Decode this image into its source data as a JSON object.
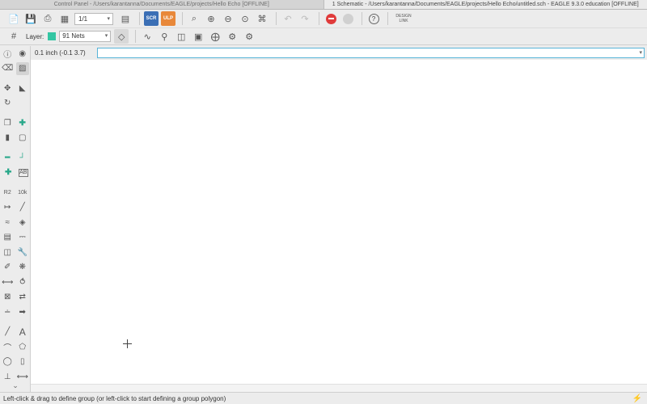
{
  "tabs": [
    {
      "label": "Control Panel - /Users/karantanna/Documents/EAGLE/projects/Hello Echo [OFFLINE]"
    },
    {
      "label": "1 Schematic - /Users/karantanna/Documents/EAGLE/projects/Hello Echo/untitled.sch - EAGLE 9.3.0 education [OFFLINE]"
    }
  ],
  "toolbar": {
    "sheet": "1/1",
    "scr": "SCR",
    "ulp": "ULP",
    "help": "?",
    "design_link": "DESIGN LINK"
  },
  "toolbar2": {
    "layer_label": "Layer:",
    "layer_value": "91 Nets",
    "layer_color": "#34c6a3"
  },
  "coord": "0.1 inch (-0.1 3.7)",
  "command": {
    "value": ""
  },
  "status": "Left-click & drag to define group (or left-click to start defining a group polygon)",
  "palette_labels": {
    "r2": "R2",
    "10k": "10k",
    "ab": "AB",
    "text": "A"
  }
}
